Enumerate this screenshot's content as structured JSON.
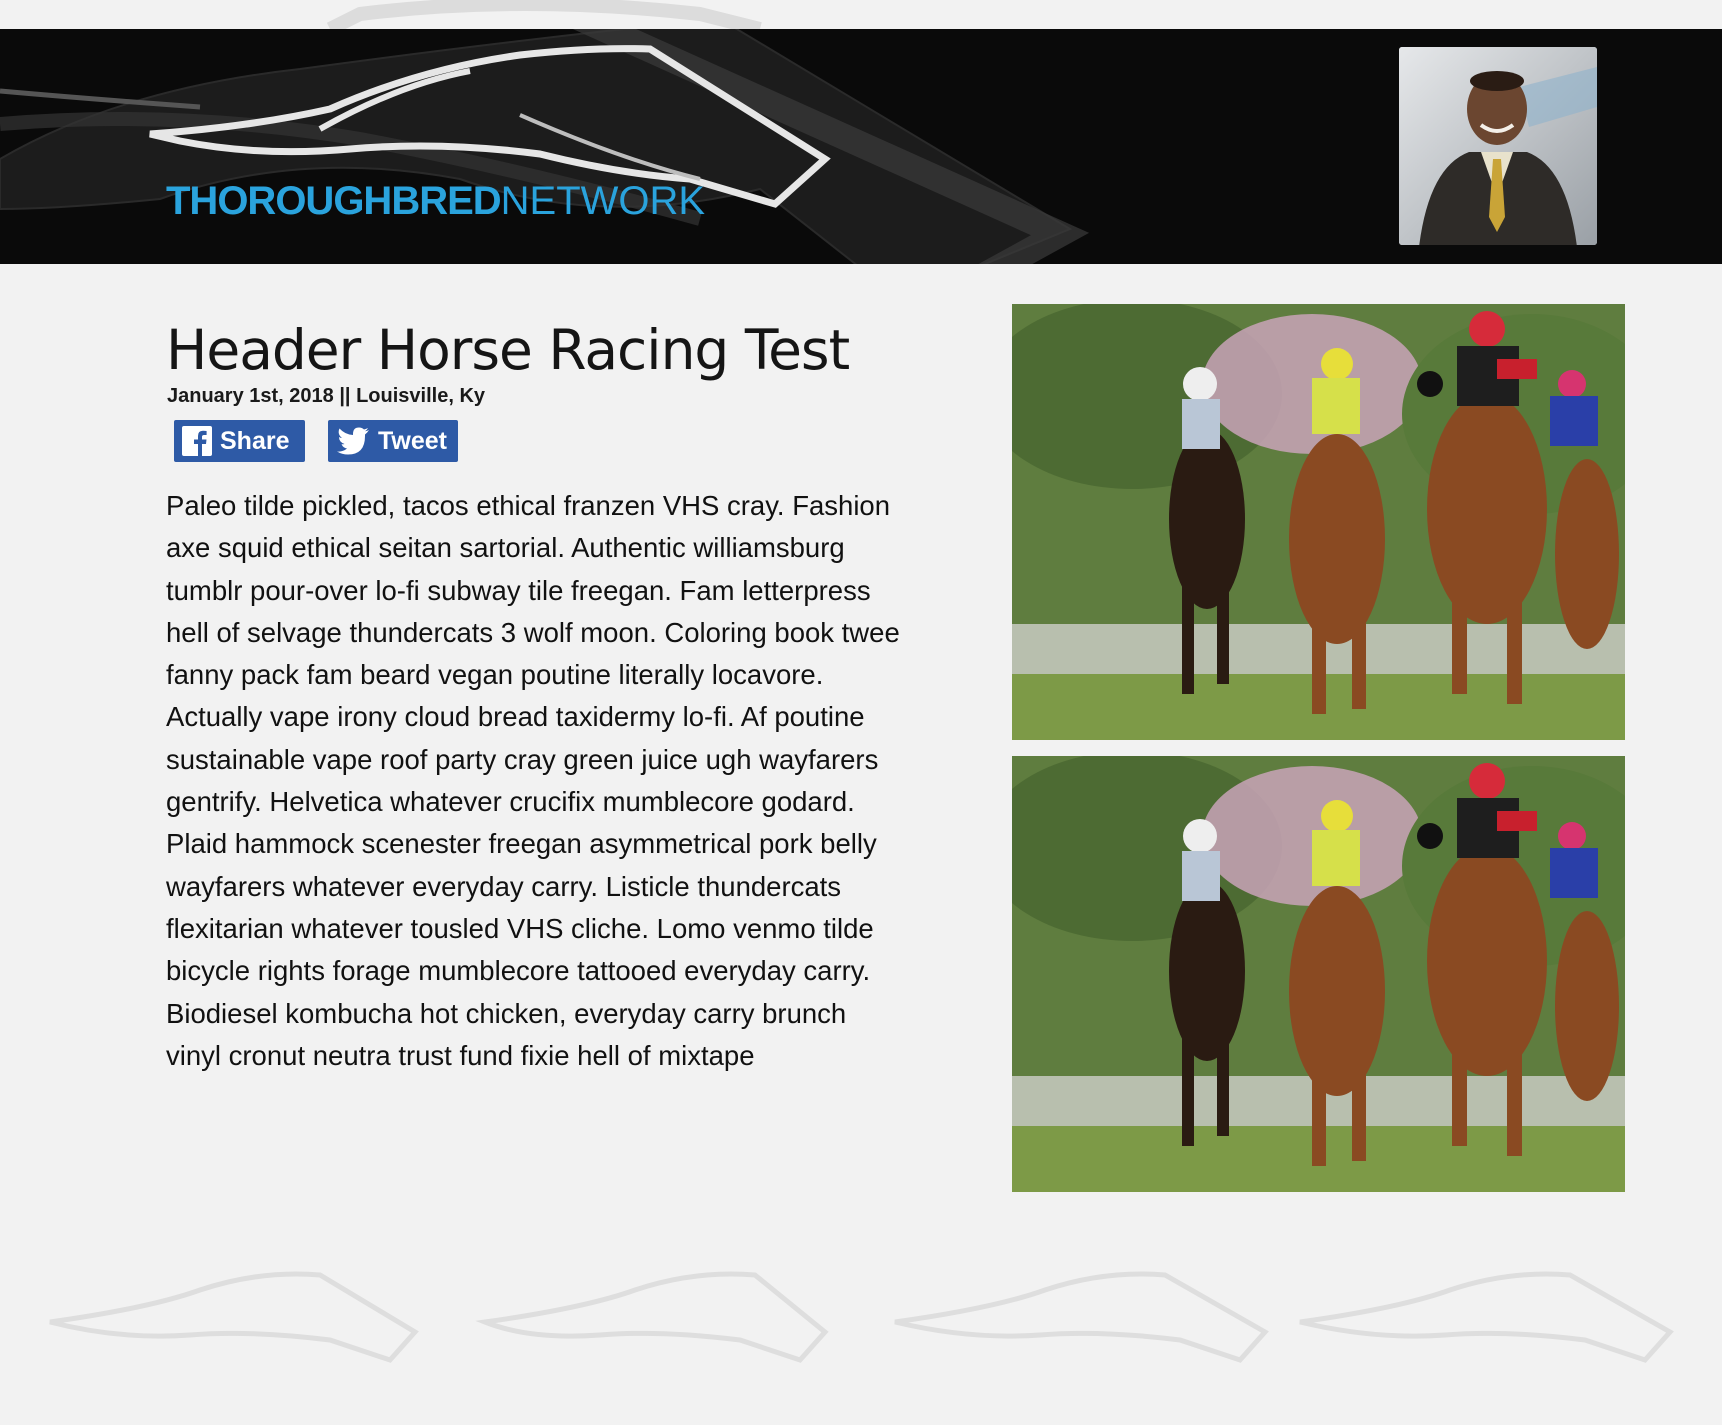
{
  "brand": {
    "name_bold": "THOROUGHBRED",
    "name_light": "NETWORK",
    "accent_color": "#2aa3dd",
    "header_bg": "#0a0a0a"
  },
  "avatar": {
    "icon": "user-portrait"
  },
  "article": {
    "title": "Header Horse Racing Test",
    "byline": "January 1st, 2018 || Louisville, Ky",
    "body": "Paleo tilde pickled, tacos ethical franzen VHS cray. Fashion axe squid ethical seitan sartorial. Authentic williamsburg tumblr pour-over lo-fi subway tile freegan. Fam letterpress hell of selvage thundercats 3 wolf moon. Coloring book twee fanny pack fam beard vegan poutine literally locavore. Actually vape irony cloud bread taxidermy lo-fi. Af poutine sustainable vape roof party cray green juice ugh wayfarers gentrify. Helvetica whatever crucifix mumblecore godard. Plaid hammock scenester freegan asymmetrical pork belly wayfarers whatever everyday carry. Listicle thundercats flexitarian whatever tousled VHS cliche. Lomo venmo tilde bicycle rights forage mumblecore tattooed everyday carry. Biodiesel kombucha hot chicken, everyday carry brunch vinyl cronut neutra trust fund fixie hell of mixtape"
  },
  "share": {
    "facebook_label": "Share",
    "twitter_label": "Tweet",
    "facebook_icon": "facebook-icon",
    "twitter_icon": "twitter-bird-icon",
    "button_color": "#2e5aa6"
  },
  "photos": [
    {
      "subject": "horse-race-photo"
    },
    {
      "subject": "horse-race-photo"
    }
  ]
}
